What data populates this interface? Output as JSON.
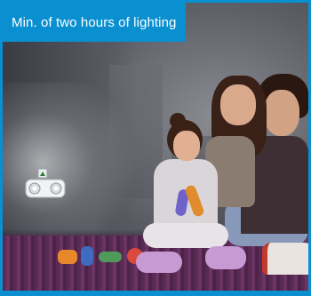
{
  "banner": {
    "text": "Min. of two hours of lighting"
  },
  "colors": {
    "brand_blue": "#0a8fd0"
  },
  "icons": {
    "product": "emergency-light-icon"
  }
}
